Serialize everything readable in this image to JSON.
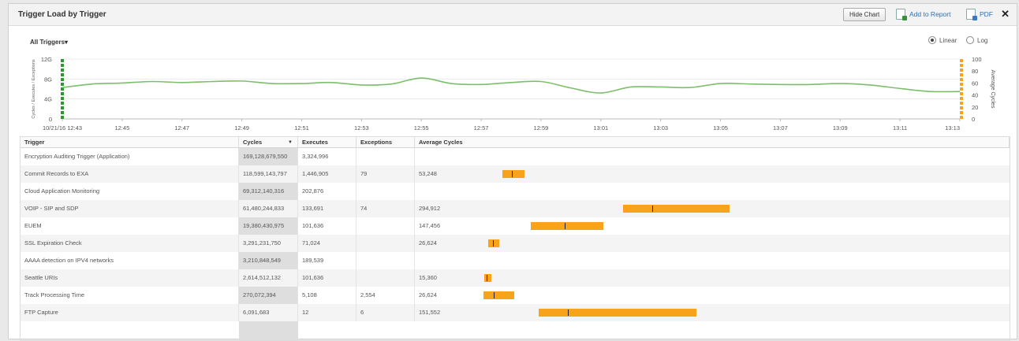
{
  "window": {
    "title": "Trigger Load by Trigger",
    "hide_chart": "Hide Chart",
    "add_to_report": "Add to Report",
    "pdf": "PDF",
    "close": "✕"
  },
  "chart_data": {
    "type": "line",
    "title": "All Triggers",
    "scale_options": [
      "Linear",
      "Log"
    ],
    "selected_scale": "Linear",
    "y_left": {
      "label": "Cycles / Executes / Exceptions",
      "ticks": [
        "12G",
        "8G",
        "4G",
        "0"
      ],
      "range": [
        0,
        12
      ]
    },
    "y_right": {
      "label": "Average Cycles",
      "ticks": [
        "100",
        "80",
        "60",
        "40",
        "20",
        "0"
      ],
      "range": [
        0,
        100
      ]
    },
    "x_ticks": [
      "10/21/16 12:43",
      "12:45",
      "12:47",
      "12:49",
      "12:51",
      "12:53",
      "12:55",
      "12:57",
      "12:59",
      "13:01",
      "13:03",
      "13:05",
      "13:07",
      "13:09",
      "13:11",
      "13:13"
    ],
    "series": [
      {
        "color": "#7cbf6a",
        "x": [
          "12:43",
          "12:44",
          "12:45",
          "12:46",
          "12:47",
          "12:48",
          "12:49",
          "12:50",
          "12:51",
          "12:52",
          "12:53",
          "12:54",
          "12:55",
          "12:56",
          "12:57",
          "12:58",
          "12:59",
          "13:00",
          "13:01",
          "13:02",
          "13:03",
          "13:04",
          "13:05",
          "13:06",
          "13:07",
          "13:08",
          "13:09",
          "13:10",
          "13:11",
          "13:12",
          "13:13"
        ],
        "y": [
          6.3,
          7.0,
          7.2,
          7.5,
          7.3,
          7.5,
          7.6,
          7.1,
          7.1,
          7.3,
          6.8,
          7.0,
          8.2,
          7.1,
          6.9,
          7.3,
          7.5,
          6.2,
          5.2,
          6.4,
          6.4,
          6.3,
          7.1,
          7.0,
          6.9,
          6.9,
          7.1,
          6.8,
          6.1,
          5.5,
          5.5
        ]
      }
    ],
    "markers": [
      {
        "side": "left",
        "color": "#2a9a2a"
      },
      {
        "side": "right",
        "color": "#f7a31b"
      }
    ]
  },
  "table": {
    "columns": [
      "Trigger",
      "Cycles",
      "Executes",
      "Exceptions",
      "Average Cycles"
    ],
    "sort_indicator": "▼",
    "avg_axis_max": 500000,
    "rows": [
      {
        "trigger": "Encryption Auditing Trigger (Application)",
        "cycles": "169,128,679,550",
        "executes": "3,324,996",
        "exceptions": "",
        "avg": "",
        "range": null
      },
      {
        "trigger": "Commit Records to EXA",
        "cycles": "118,599,143,797",
        "executes": "1,446,905",
        "exceptions": "79",
        "avg": "53,248",
        "range": [
          37000,
          57000
        ],
        "value": 46000
      },
      {
        "trigger": "Cloud Application Monitoring",
        "cycles": "69,312,140,316",
        "executes": "202,876",
        "exceptions": "",
        "avg": "",
        "range": null
      },
      {
        "trigger": "VOIP - SIP and SDP",
        "cycles": "61,480,244,833",
        "executes": "133,691",
        "exceptions": "74",
        "avg": "294,912",
        "range": [
          148000,
          246000
        ],
        "value": 175000
      },
      {
        "trigger": "EUEM",
        "cycles": "19,380,430,975",
        "executes": "101,636",
        "exceptions": "",
        "avg": "147,456",
        "range": [
          63000,
          130000
        ],
        "value": 94000
      },
      {
        "trigger": "SSL Expiration Check",
        "cycles": "3,291,231,750",
        "executes": "71,024",
        "exceptions": "",
        "avg": "26,624",
        "range": [
          24000,
          34000
        ],
        "value": 28500
      },
      {
        "trigger": "AAAA detection on IPV4 networks",
        "cycles": "3,210,848,549",
        "executes": "189,539",
        "exceptions": "",
        "avg": "",
        "range": null
      },
      {
        "trigger": "Seattle URIs",
        "cycles": "2,614,512,132",
        "executes": "101,636",
        "exceptions": "",
        "avg": "15,360",
        "range": [
          20500,
          26500
        ],
        "value": 22500
      },
      {
        "trigger": "Track Processing Time",
        "cycles": "270,072,394",
        "executes": "5,108",
        "exceptions": "2,554",
        "avg": "26,624",
        "range": [
          19500,
          48000
        ],
        "value": 29000
      },
      {
        "trigger": "FTP Capture",
        "cycles": "6,091,683",
        "executes": "12",
        "exceptions": "6",
        "avg": "151,552",
        "range": [
          70000,
          215000
        ],
        "value": 97000
      }
    ]
  }
}
